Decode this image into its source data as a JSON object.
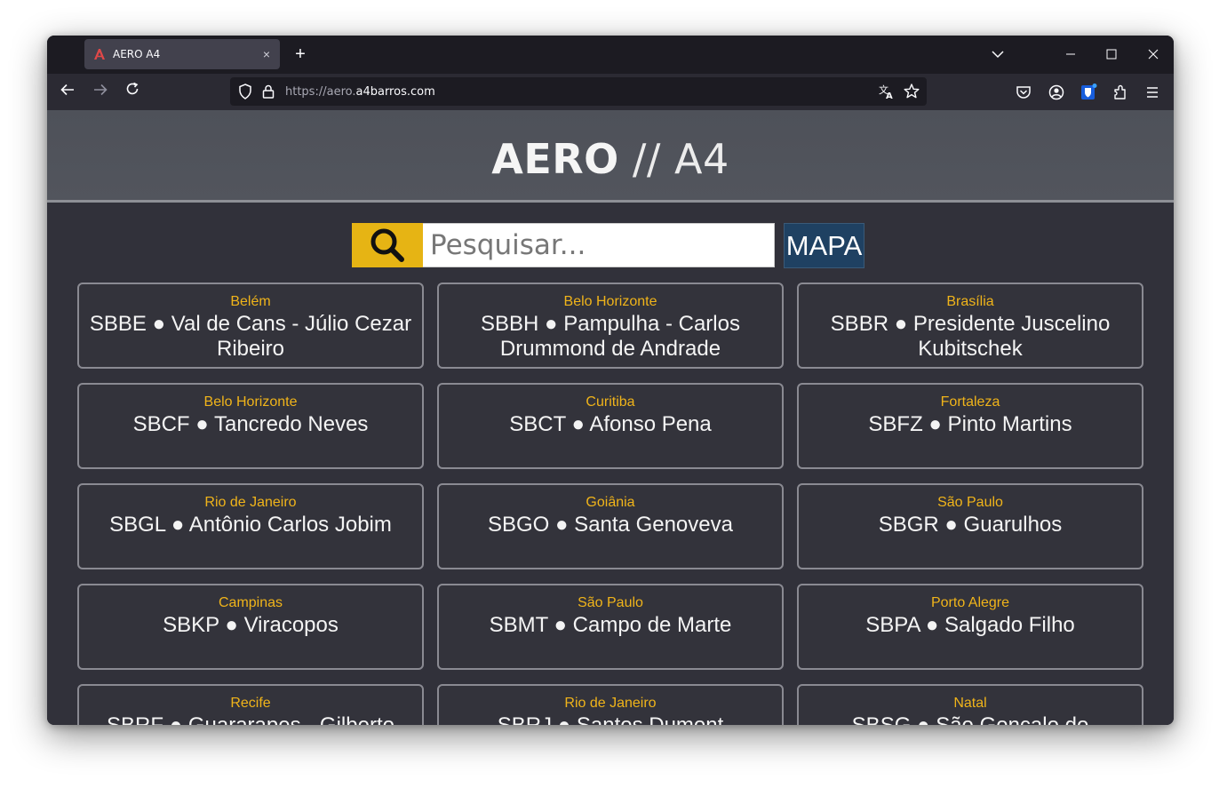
{
  "browser": {
    "tab_title": "AERO A4",
    "url_dim": "https://aero.",
    "url_main": "a4barros.com",
    "new_tab_glyph": "+",
    "tab_close_glyph": "×"
  },
  "header": {
    "brand_bold": "AERO",
    "brand_rest": " // A4"
  },
  "search": {
    "placeholder": "Pesquisar...",
    "value": ""
  },
  "map_button": "MAPA",
  "colors": {
    "accent": "#e6b414",
    "city": "#f0b41a",
    "map_button": "#1f4162",
    "page_bg": "#31313a"
  },
  "airports": [
    {
      "city": "Belém",
      "name": "SBBE ● Val de Cans - Júlio Cezar Ribeiro"
    },
    {
      "city": "Belo Horizonte",
      "name": "SBBH ● Pampulha - Carlos Drummond de Andrade"
    },
    {
      "city": "Brasília",
      "name": "SBBR ● Presidente Juscelino Kubitschek"
    },
    {
      "city": "Belo Horizonte",
      "name": "SBCF ● Tancredo Neves"
    },
    {
      "city": "Curitiba",
      "name": "SBCT ● Afonso Pena"
    },
    {
      "city": "Fortaleza",
      "name": "SBFZ ● Pinto Martins"
    },
    {
      "city": "Rio de Janeiro",
      "name": "SBGL ● Antônio Carlos Jobim"
    },
    {
      "city": "Goiânia",
      "name": "SBGO ● Santa Genoveva"
    },
    {
      "city": "São Paulo",
      "name": "SBGR ● Guarulhos"
    },
    {
      "city": "Campinas",
      "name": "SBKP ● Viracopos"
    },
    {
      "city": "São Paulo",
      "name": "SBMT ● Campo de Marte"
    },
    {
      "city": "Porto Alegre",
      "name": "SBPA ● Salgado Filho"
    },
    {
      "city": "Recife",
      "name": "SBRF ● Guararapes - Gilberto"
    },
    {
      "city": "Rio de Janeiro",
      "name": "SBRJ ● Santos Dumont"
    },
    {
      "city": "Natal",
      "name": "SBSG ● São Gonçalo do"
    }
  ]
}
